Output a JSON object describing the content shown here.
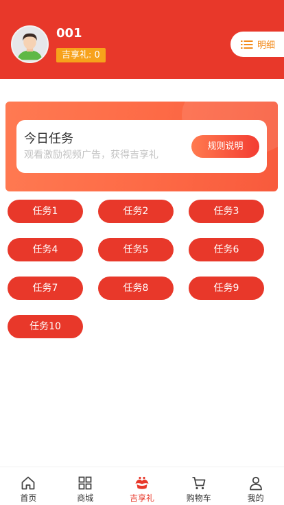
{
  "header": {
    "username": "001",
    "points_label": "吉享礼: 0",
    "detail_label": "明细",
    "accent_color": "#e8382a"
  },
  "banner": {
    "title": "今日任务",
    "subtitle": "观看激励视频广告，获得吉享礼",
    "rules_label": "规则说明"
  },
  "tasks": [
    {
      "label": "任务1"
    },
    {
      "label": "任务2"
    },
    {
      "label": "任务3"
    },
    {
      "label": "任务4"
    },
    {
      "label": "任务5"
    },
    {
      "label": "任务6"
    },
    {
      "label": "任务7"
    },
    {
      "label": "任务8"
    },
    {
      "label": "任务9"
    },
    {
      "label": "任务10"
    }
  ],
  "tabbar": {
    "items": [
      {
        "label": "首页",
        "icon": "home-icon"
      },
      {
        "label": "商城",
        "icon": "grid-icon"
      },
      {
        "label": "吉享礼",
        "icon": "gift-icon",
        "active": true
      },
      {
        "label": "购物车",
        "icon": "cart-icon"
      },
      {
        "label": "我的",
        "icon": "user-icon"
      }
    ]
  }
}
